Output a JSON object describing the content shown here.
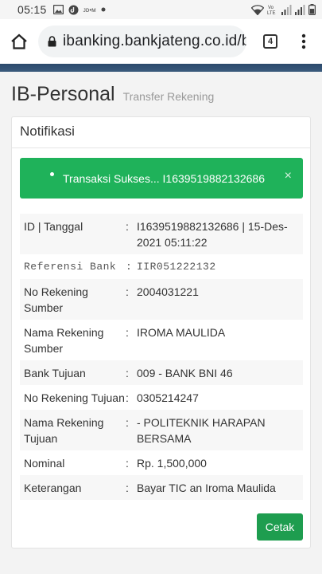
{
  "statusbar": {
    "time": "05:15",
    "left_icons": [
      "image-icon",
      "app-icon",
      "notification-text-icon",
      "dot-icon"
    ],
    "notification_text": "ᴊᴅ•ᴍ",
    "right_icons": [
      "wifi-icon",
      "volte-icon",
      "signal-icon",
      "signal-icon",
      "battery-icon"
    ],
    "volte_text": "Vo))\nLTE"
  },
  "browser": {
    "url": "ibanking.bankjateng.co.id/bp",
    "tab_count": "4"
  },
  "header": {
    "title": "IB-Personal",
    "subtitle": "Transfer Rekening"
  },
  "card": {
    "title": "Notifikasi",
    "alert": {
      "message": "Transaksi Sukses... I1639519882132686",
      "close": "×",
      "color": "#1fb25a"
    },
    "rows": [
      {
        "label": "ID | Tanggal",
        "colon": ":",
        "value": "I1639519882132686 | 15-Des-2021 05:11:22"
      },
      {
        "label": "Referensi Bank",
        "colon": ":",
        "value": "IIR051222132"
      },
      {
        "label": "No Rekening Sumber",
        "colon": ":",
        "value": "2004031221"
      },
      {
        "label": "Nama Rekening Sumber",
        "colon": ":",
        "value": "IROMA MAULIDA"
      },
      {
        "label": "Bank Tujuan",
        "colon": ":",
        "value": "009 - BANK BNI 46"
      },
      {
        "label": "No Rekening Tujuan",
        "colon": ":",
        "value": "0305214247"
      },
      {
        "label": "Nama Rekening Tujuan",
        "colon": ":",
        "value": "- POLITEKNIK HARAPAN BERSAMA"
      },
      {
        "label": "Nominal",
        "colon": ":",
        "value": "Rp. 1,500,000"
      },
      {
        "label": "Keterangan",
        "colon": ":",
        "value": "Bayar TIC an Iroma Maulida"
      }
    ],
    "print_label": "Cetak",
    "button_color": "#1e9d4f"
  }
}
